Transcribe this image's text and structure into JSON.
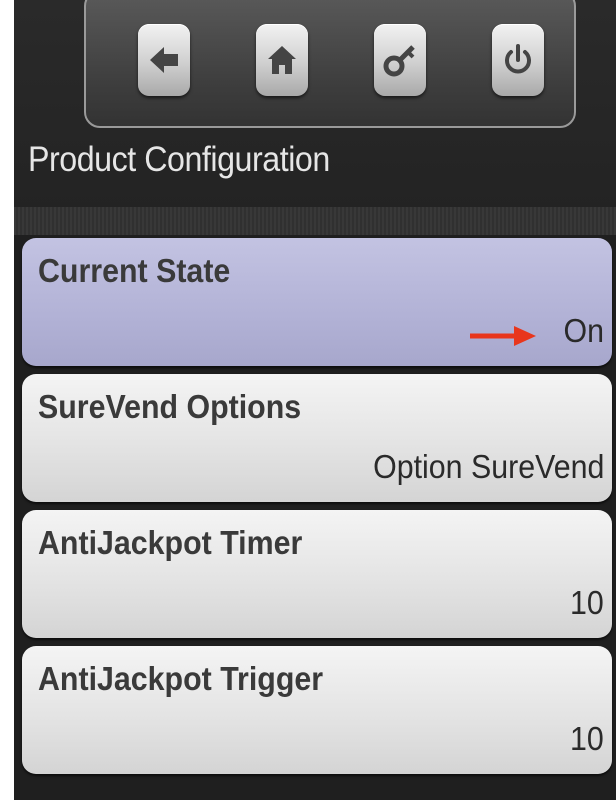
{
  "header": {
    "title": "Product Configuration",
    "toolbar": [
      {
        "icon": "back-arrow-icon"
      },
      {
        "icon": "home-icon"
      },
      {
        "icon": "key-icon"
      },
      {
        "icon": "power-icon"
      }
    ]
  },
  "list": {
    "items": [
      {
        "label": "Current State",
        "value": "On",
        "selected": true
      },
      {
        "label": "SureVend Options",
        "value": "Option SureVend",
        "selected": false
      },
      {
        "label": "AntiJackpot Timer",
        "value": "10",
        "selected": false
      },
      {
        "label": "AntiJackpot Trigger",
        "value": "10",
        "selected": false
      }
    ]
  },
  "colors": {
    "selected_row": "#b2b2d6",
    "row": "#e2e2e2",
    "annotation_arrow": "#e8361c"
  }
}
